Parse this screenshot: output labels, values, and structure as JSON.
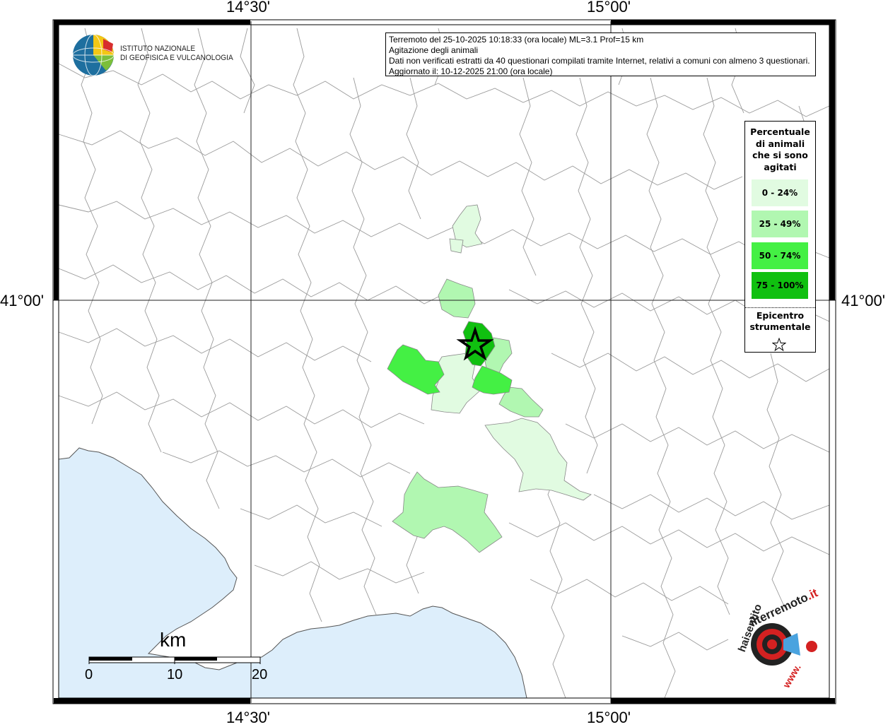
{
  "map": {
    "coords": {
      "lon_left": "14°30'",
      "lon_right": "15°00'",
      "lat": "41°00'"
    },
    "info_box": {
      "line1": "Terremoto del 25-10-2025 10:18:33 (ora locale) ML=3.1 Prof=15 km",
      "line2": "Agitazione degli animali",
      "line3": "Dati non verificati estratti da 40 questionari compilati tramite Internet, relativi a comuni con almeno 3 questionari.",
      "line4": "Aggiornato il: 10-12-2025 21:00 (ora locale)"
    },
    "logo": {
      "line1": "ISTITUTO NAZIONALE",
      "line2": "DI GEOFISICA E VULCANOLOGIA"
    },
    "legend": {
      "title_lines": [
        "Percentuale",
        "di animali",
        "che si sono",
        "agitati"
      ],
      "classes": [
        {
          "label": "0 - 24%",
          "color": "#e1fbe1"
        },
        {
          "label": "25 - 49%",
          "color": "#b1f7b1"
        },
        {
          "label": "50 - 74%",
          "color": "#44f044"
        },
        {
          "label": "75 - 100%",
          "color": "#10c010"
        }
      ],
      "epicenter_lines": [
        "Epicentro",
        "strumentale"
      ]
    },
    "scale": {
      "unit": "km",
      "ticks": [
        "0",
        "10",
        "20"
      ]
    },
    "watermark": "www.haisentitoilterremoto.it",
    "colors": {
      "sea": "#ddeefb",
      "border": "#9a9a9a",
      "frame": "#000000"
    }
  }
}
